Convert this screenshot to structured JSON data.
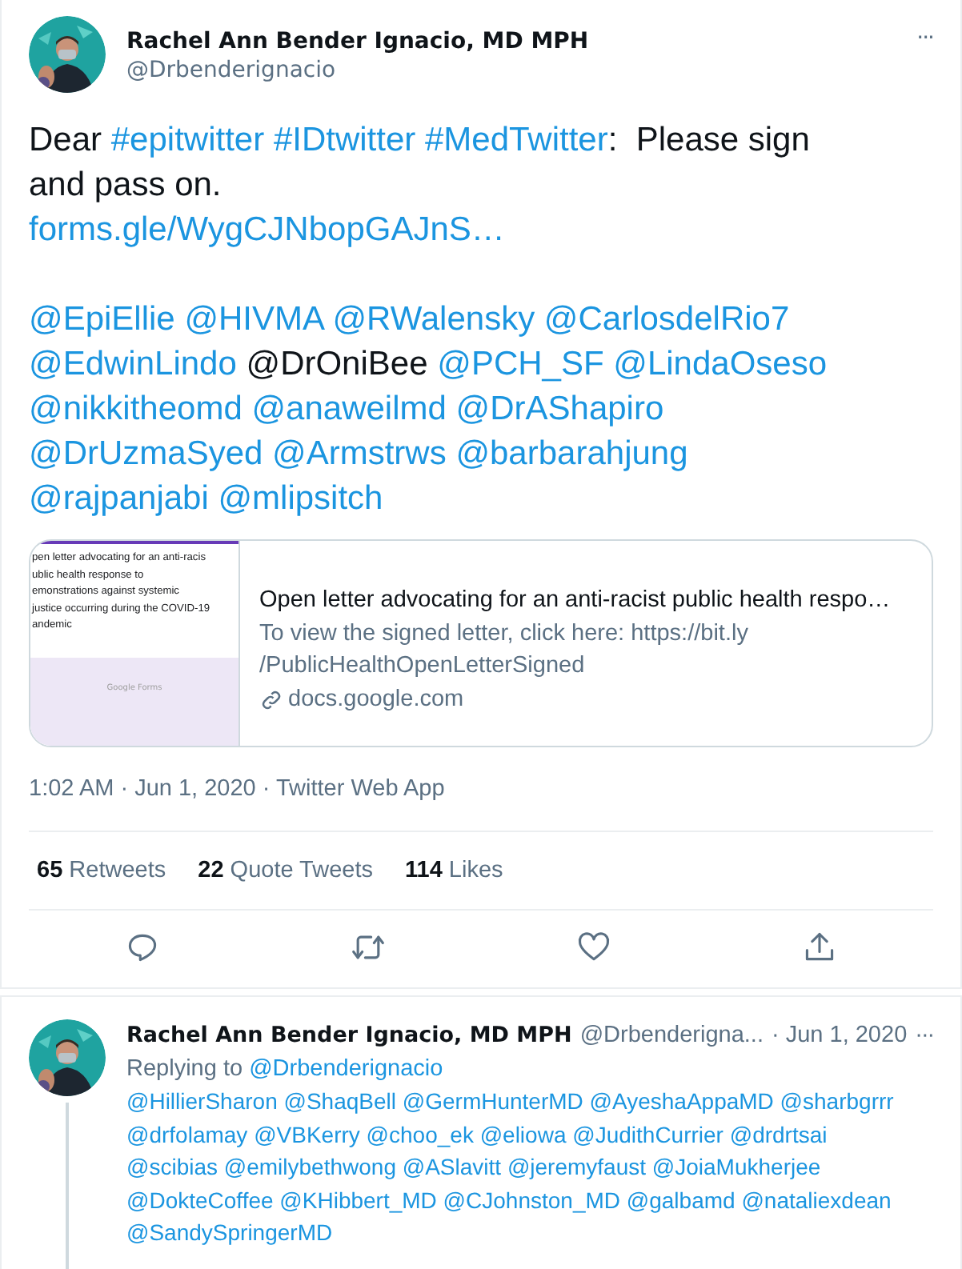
{
  "tweet": {
    "name": "Rachel Ann Bender Ignacio, MD MPH",
    "handle": "@Drbenderignacio",
    "more": "···",
    "paragraphs": [
      [
        [
          {
            "kind": "text",
            "text": "Dear"
          },
          {
            "kind": "link",
            "text": "#epitwitter"
          },
          {
            "kind": "link",
            "text": "#IDtwitter"
          },
          {
            "kind": "link",
            "text": "#MedTwitter"
          },
          {
            "kind": "tail",
            "text": ":  Please sign"
          }
        ],
        [
          {
            "kind": "text",
            "text": "and pass on."
          }
        ],
        [
          {
            "kind": "link",
            "text": "forms.gle/WygCJNbopGAJnS…"
          }
        ]
      ],
      [
        [
          {
            "kind": "link",
            "text": "@EpiEllie"
          },
          {
            "kind": "link",
            "text": "@HIVMA"
          },
          {
            "kind": "link",
            "text": "@RWalensky"
          },
          {
            "kind": "link",
            "text": "@CarlosdelRio7"
          }
        ],
        [
          {
            "kind": "link",
            "text": "@EdwinLindo"
          },
          {
            "kind": "text",
            "text": "@DrOniBee"
          },
          {
            "kind": "link",
            "text": "@PCH_SF"
          },
          {
            "kind": "link",
            "text": "@LindaOseso"
          }
        ],
        [
          {
            "kind": "link",
            "text": "@nikkitheomd"
          },
          {
            "kind": "link",
            "text": "@anaweilmd"
          },
          {
            "kind": "link",
            "text": "@DrAShapiro"
          }
        ],
        [
          {
            "kind": "link",
            "text": "@DrUzmaSyed"
          },
          {
            "kind": "link",
            "text": "@Armstrws"
          },
          {
            "kind": "link",
            "text": "@barbarahjung"
          }
        ],
        [
          {
            "kind": "link",
            "text": "@rajpanjabi"
          },
          {
            "kind": "link",
            "text": "@mlipsitch"
          }
        ]
      ]
    ],
    "card": {
      "thumbnail_lines": [
        "pen letter advocating for an anti-racis",
        "ublic health response to",
        "emonstrations against systemic",
        "justice occurring during the COVID-19",
        "andemic"
      ],
      "thumbnail_logo": "Google Forms",
      "title": "Open letter advocating for an anti-racist public health respo…",
      "description": "To view the signed letter, click here: https://bit.ly /PublicHealthOpenLetterSigned",
      "domain": "docs.google.com"
    },
    "timestamp": "1:02 AM · Jun 1, 2020 · Twitter Web App",
    "stats": [
      {
        "count": "65",
        "label": "Retweets"
      },
      {
        "count": "22",
        "label": "Quote Tweets"
      },
      {
        "count": "114",
        "label": "Likes"
      }
    ],
    "actions": [
      {
        "kind": "reply"
      },
      {
        "kind": "retweet"
      },
      {
        "kind": "like"
      },
      {
        "kind": "share"
      }
    ]
  },
  "reply": {
    "name": "Rachel Ann Bender Ignacio, MD MPH",
    "handle": "@Drbenderigna...",
    "date": "· Jun 1, 2020",
    "more": "···",
    "replying_prefix": "Replying to",
    "replying_to": "@Drbenderignacio",
    "lines": [
      "@HillierSharon @ShaqBell @GermHunterMD @AyeshaAppaMD @sharbgrrr",
      "@drfolamay @VBKerry @choo_ek @eliowa @JudithCurrier @drdrtsai",
      "@scibias @emilybethwong @ASlavitt @jeremyfaust @JoiaMukherjee",
      "@DokteCoffee  @KHibbert_MD @CJohnston_MD @galbamd @nataliexdean",
      "@SandySpringerMD"
    ]
  }
}
